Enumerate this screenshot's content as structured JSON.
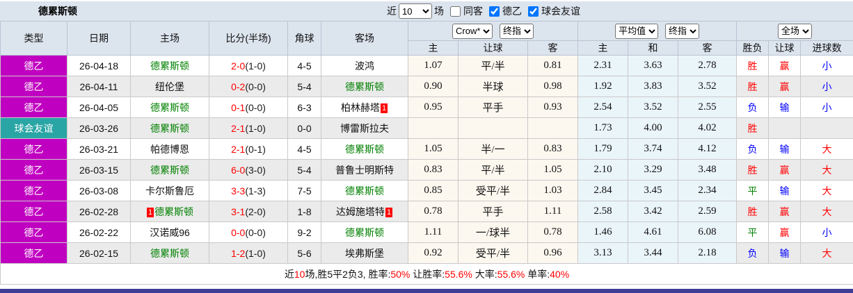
{
  "title": "德累斯顿",
  "controls": {
    "near_label": "近",
    "matches_count": "10",
    "matches_label": "场",
    "checkboxes": [
      {
        "label": "同客",
        "checked": false
      },
      {
        "label": "德乙",
        "checked": true
      },
      {
        "label": "球会友谊",
        "checked": true
      }
    ]
  },
  "header": {
    "left_columns": [
      "类型",
      "日期",
      "主场",
      "比分(半场)",
      "角球",
      "客场"
    ],
    "odds_selects": [
      "Crow*",
      "终指"
    ],
    "avg_selects": [
      "平均值",
      "终指"
    ],
    "result_select": "全场",
    "odds_subcols": [
      "主",
      "让球",
      "客"
    ],
    "avg_subcols": [
      "主",
      "和",
      "客"
    ],
    "result_subcols": [
      "胜负",
      "让球",
      "进球数"
    ]
  },
  "colors": {
    "magenta": "#c000c0",
    "teal": "#2aa5a5",
    "red": "#fe0000",
    "blue": "#0000fe",
    "green": "#008000",
    "focus_team": "#008000",
    "cream_bg": "#fdf8ef",
    "lightblue_bg": "#eaf5fa",
    "navy_bar": "#3d3d96"
  },
  "rows": [
    {
      "type": "德乙",
      "type_color": "magenta",
      "date": "26-04-18",
      "home": {
        "name": "德累斯顿",
        "focus": true
      },
      "score": "2-0",
      "half": "(1-0)",
      "corner": "4-5",
      "away": {
        "name": "波鸿",
        "focus": false
      },
      "odds": [
        "1.07",
        "平/半",
        "0.81"
      ],
      "avg": [
        "2.31",
        "3.63",
        "2.78"
      ],
      "results": [
        {
          "text": "胜",
          "color": "red"
        },
        {
          "text": "赢",
          "color": "red"
        },
        {
          "text": "小",
          "color": "blue"
        }
      ]
    },
    {
      "type": "德乙",
      "type_color": "magenta",
      "date": "26-04-11",
      "home": {
        "name": "纽伦堡",
        "focus": false
      },
      "score": "0-2",
      "half": "(0-0)",
      "corner": "5-4",
      "away": {
        "name": "德累斯顿",
        "focus": true
      },
      "odds": [
        "0.90",
        "半球",
        "0.98"
      ],
      "avg": [
        "1.92",
        "3.83",
        "3.52"
      ],
      "results": [
        {
          "text": "胜",
          "color": "red"
        },
        {
          "text": "赢",
          "color": "red"
        },
        {
          "text": "小",
          "color": "blue"
        }
      ]
    },
    {
      "type": "德乙",
      "type_color": "magenta",
      "date": "26-04-05",
      "home": {
        "name": "德累斯顿",
        "focus": true
      },
      "score": "0-1",
      "half": "(0-0)",
      "corner": "6-3",
      "away": {
        "name": "柏林赫塔",
        "focus": false,
        "badge_after": "1"
      },
      "odds": [
        "0.95",
        "平手",
        "0.93"
      ],
      "avg": [
        "2.54",
        "3.52",
        "2.55"
      ],
      "results": [
        {
          "text": "负",
          "color": "blue"
        },
        {
          "text": "输",
          "color": "blue"
        },
        {
          "text": "小",
          "color": "blue"
        }
      ]
    },
    {
      "type": "球会友谊",
      "type_color": "teal",
      "date": "26-03-26",
      "home": {
        "name": "德累斯顿",
        "focus": true
      },
      "score": "2-1",
      "half": "(1-0)",
      "corner": "0-0",
      "away": {
        "name": "博雷斯拉夫",
        "focus": false
      },
      "odds": [
        "",
        "",
        ""
      ],
      "avg": [
        "1.73",
        "4.00",
        "4.02"
      ],
      "results": [
        {
          "text": "胜",
          "color": "red"
        },
        {
          "text": "",
          "color": "red"
        },
        {
          "text": "",
          "color": "red"
        }
      ]
    },
    {
      "type": "德乙",
      "type_color": "magenta",
      "date": "26-03-21",
      "home": {
        "name": "帕德博恩",
        "focus": false
      },
      "score": "2-1",
      "half": "(0-1)",
      "corner": "4-5",
      "away": {
        "name": "德累斯顿",
        "focus": true
      },
      "odds": [
        "1.05",
        "半/一",
        "0.83"
      ],
      "avg": [
        "1.79",
        "3.74",
        "4.12"
      ],
      "results": [
        {
          "text": "负",
          "color": "blue"
        },
        {
          "text": "输",
          "color": "blue"
        },
        {
          "text": "大",
          "color": "red"
        }
      ]
    },
    {
      "type": "德乙",
      "type_color": "magenta",
      "date": "26-03-15",
      "home": {
        "name": "德累斯顿",
        "focus": true
      },
      "score": "6-0",
      "half": "(3-0)",
      "corner": "5-4",
      "away": {
        "name": "普鲁士明斯特",
        "focus": false
      },
      "odds": [
        "0.83",
        "平/半",
        "1.05"
      ],
      "avg": [
        "2.10",
        "3.29",
        "3.48"
      ],
      "results": [
        {
          "text": "胜",
          "color": "red"
        },
        {
          "text": "赢",
          "color": "red"
        },
        {
          "text": "大",
          "color": "red"
        }
      ]
    },
    {
      "type": "德乙",
      "type_color": "magenta",
      "date": "26-03-08",
      "home": {
        "name": "卡尔斯鲁厄",
        "focus": false
      },
      "score": "3-3",
      "half": "(1-3)",
      "corner": "7-5",
      "away": {
        "name": "德累斯顿",
        "focus": true
      },
      "odds": [
        "0.85",
        "受平/半",
        "1.03"
      ],
      "avg": [
        "2.84",
        "3.45",
        "2.34"
      ],
      "results": [
        {
          "text": "平",
          "color": "green"
        },
        {
          "text": "输",
          "color": "blue"
        },
        {
          "text": "大",
          "color": "red"
        }
      ]
    },
    {
      "type": "德乙",
      "type_color": "magenta",
      "date": "26-02-28",
      "home": {
        "name": "德累斯顿",
        "focus": true,
        "badge_before": "1"
      },
      "score": "3-1",
      "half": "(2-0)",
      "corner": "1-8",
      "away": {
        "name": "达姆施塔特",
        "focus": false,
        "badge_after": "1"
      },
      "odds": [
        "0.78",
        "平手",
        "1.11"
      ],
      "avg": [
        "2.58",
        "3.42",
        "2.59"
      ],
      "results": [
        {
          "text": "胜",
          "color": "red"
        },
        {
          "text": "赢",
          "color": "red"
        },
        {
          "text": "大",
          "color": "red"
        }
      ]
    },
    {
      "type": "德乙",
      "type_color": "magenta",
      "date": "26-02-22",
      "home": {
        "name": "汉诺威96",
        "focus": false
      },
      "score": "0-0",
      "half": "(0-0)",
      "corner": "9-2",
      "away": {
        "name": "德累斯顿",
        "focus": true
      },
      "odds": [
        "1.11",
        "一/球半",
        "0.78"
      ],
      "avg": [
        "1.46",
        "4.61",
        "6.08"
      ],
      "results": [
        {
          "text": "平",
          "color": "green"
        },
        {
          "text": "赢",
          "color": "red"
        },
        {
          "text": "小",
          "color": "blue"
        }
      ]
    },
    {
      "type": "德乙",
      "type_color": "magenta",
      "date": "26-02-15",
      "home": {
        "name": "德累斯顿",
        "focus": true
      },
      "score": "1-2",
      "half": "(1-0)",
      "corner": "5-6",
      "away": {
        "name": "埃弗斯堡",
        "focus": false
      },
      "odds": [
        "0.92",
        "受平/半",
        "0.96"
      ],
      "avg": [
        "3.13",
        "3.44",
        "2.18"
      ],
      "results": [
        {
          "text": "负",
          "color": "blue"
        },
        {
          "text": "输",
          "color": "blue"
        },
        {
          "text": "大",
          "color": "red"
        }
      ]
    }
  ],
  "summary": {
    "segments": [
      {
        "text": "近",
        "red": false
      },
      {
        "text": "10",
        "red": true
      },
      {
        "text": "场,胜5平2负3, 胜率:",
        "red": false
      },
      {
        "text": "50%",
        "red": true
      },
      {
        "text": " 让胜率:",
        "red": false
      },
      {
        "text": "55.6%",
        "red": true
      },
      {
        "text": " 大率:",
        "red": false
      },
      {
        "text": "55.6%",
        "red": true
      },
      {
        "text": " 单率:",
        "red": false
      },
      {
        "text": "40%",
        "red": true
      }
    ]
  }
}
